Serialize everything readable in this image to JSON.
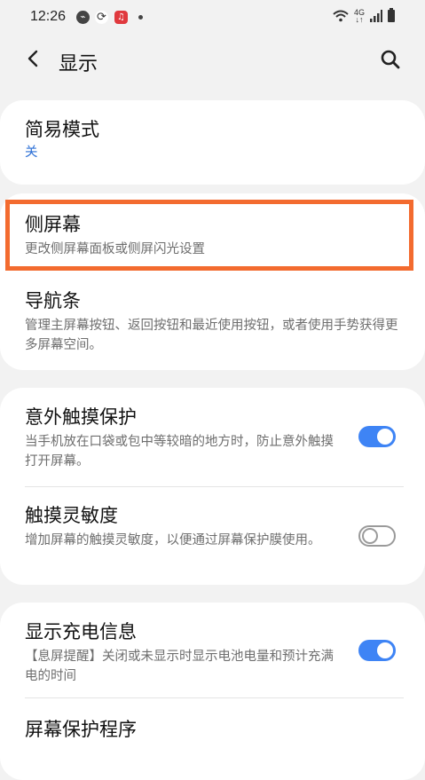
{
  "status_bar": {
    "time": "12:26",
    "network_label": "4G",
    "icons": [
      "app-icon-1",
      "sync-icon",
      "music-app-icon",
      "more-dot",
      "wifi-icon",
      "signal-icon",
      "battery-icon"
    ]
  },
  "header": {
    "title": "显示"
  },
  "cards": [
    {
      "items": [
        {
          "title": "简易模式",
          "subtitle": "关"
        }
      ]
    },
    {
      "items": [
        {
          "title": "侧屏幕",
          "subtitle": "更改侧屏幕面板或侧屏闪光设置"
        },
        {
          "title": "导航条",
          "subtitle": "管理主屏幕按钮、返回按钮和最近使用按钮，或者使用手势获得更多屏幕空间。"
        }
      ]
    },
    {
      "items": [
        {
          "title": "意外触摸保护",
          "subtitle": "当手机放在口袋或包中等较暗的地方时，防止意外触摸打开屏幕。",
          "toggle": true
        },
        {
          "title": "触摸灵敏度",
          "subtitle": "增加屏幕的触摸灵敏度，以便通过屏幕保护膜使用。",
          "toggle": false
        }
      ]
    },
    {
      "items": [
        {
          "title": "显示充电信息",
          "subtitle": "【息屏提醒】关闭或未显示时显示电池电量和预计充满电的时间",
          "toggle": true
        },
        {
          "title": "屏幕保护程序",
          "subtitle": ""
        }
      ]
    }
  ],
  "colors": {
    "accent_blue": "#3e84f5",
    "subtitle_blue": "#2b6fd6",
    "highlight_orange": "#f36b2f",
    "background": "#f2f2f2"
  }
}
